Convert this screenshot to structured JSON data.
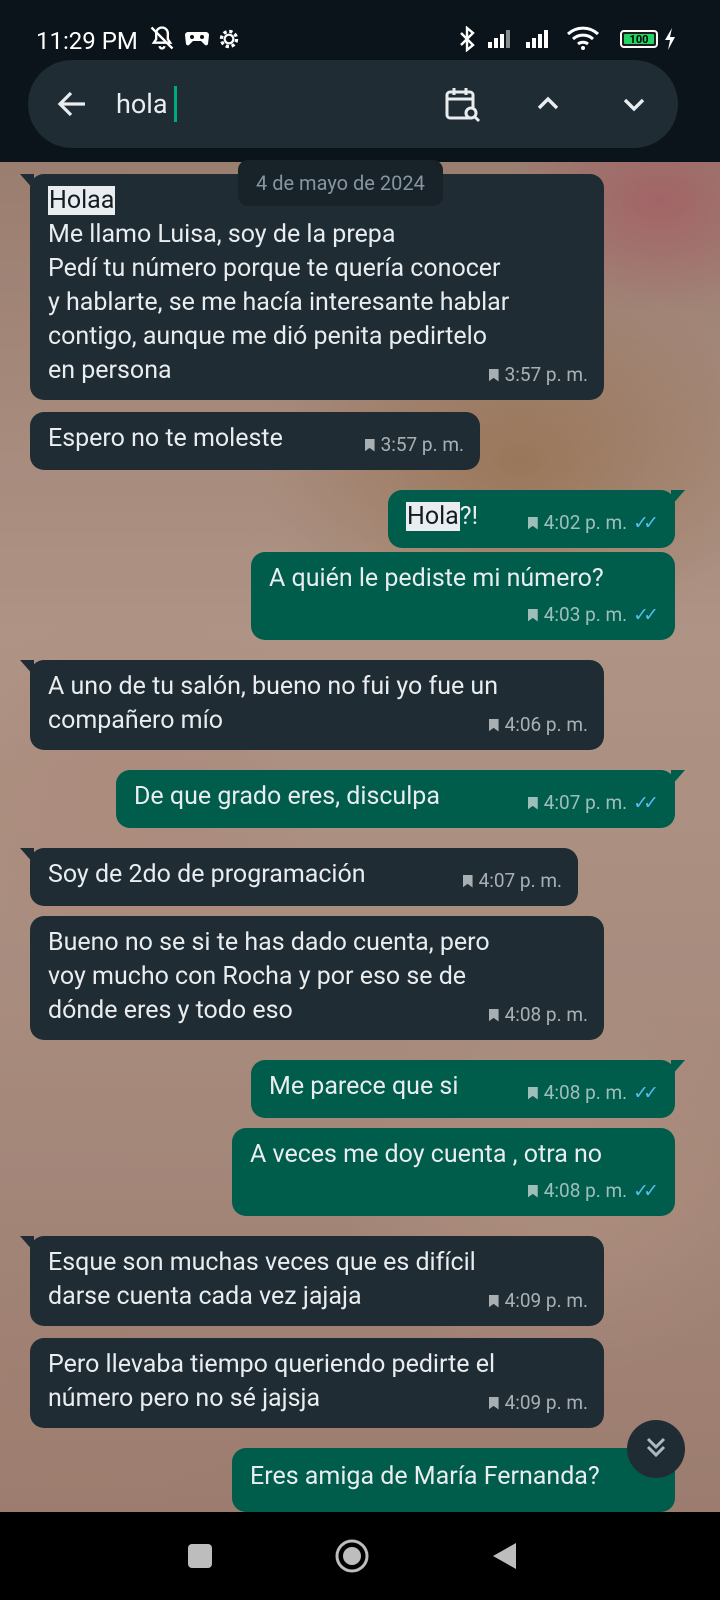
{
  "status_bar": {
    "time": "11:29 PM",
    "battery": "100",
    "icons": [
      "mute-notifications-icon",
      "gamepad-icon",
      "settings-gear-icon",
      "bluetooth-icon",
      "signal-icon",
      "signal-icon",
      "wifi-icon",
      "battery-icon",
      "charging-icon"
    ]
  },
  "search": {
    "query": "hola",
    "icons": [
      "back-arrow-icon",
      "calendar-search-icon",
      "chevron-up-icon",
      "chevron-down-icon"
    ]
  },
  "date_chip": "4 de mayo de 2024",
  "messages": [
    {
      "dir": "in",
      "highlight": "Holaa",
      "text": "\nMe llamo Luisa, soy de la prepa\nPedí tu número porque te quería conocer\ny hablarte, se me hacía interesante hablar\ncontigo, aunque me dió penita pedirtelo\nen persona",
      "time": "3:57 p. m."
    },
    {
      "dir": "in",
      "highlight": "",
      "text": "Espero no te moleste",
      "time": "3:57 p. m."
    },
    {
      "dir": "out",
      "highlight": "Hola",
      "text": "?!",
      "time": "4:02 p. m."
    },
    {
      "dir": "out",
      "highlight": "",
      "text": "A quién le pediste mi número?",
      "time": "4:03 p. m."
    },
    {
      "dir": "in",
      "highlight": "",
      "text": "A uno de tu salón, bueno no fui yo fue un\ncompañero mío",
      "time": "4:06 p. m."
    },
    {
      "dir": "out",
      "highlight": "",
      "text": "De que grado eres, disculpa",
      "time": "4:07 p. m."
    },
    {
      "dir": "in",
      "highlight": "",
      "text": "Soy de 2do de programación",
      "time": "4:07 p. m."
    },
    {
      "dir": "in",
      "highlight": "",
      "text": "Bueno no se si te has dado cuenta, pero\nvoy mucho con Rocha y por eso se de\ndónde eres y todo eso",
      "time": "4:08 p. m."
    },
    {
      "dir": "out",
      "highlight": "",
      "text": "Me parece que si",
      "time": "4:08 p. m."
    },
    {
      "dir": "out",
      "highlight": "",
      "text": "A veces me doy cuenta , otra no",
      "time": "4:08 p. m."
    },
    {
      "dir": "in",
      "highlight": "",
      "text": "Esque son muchas veces que es difícil\ndarse cuenta cada vez jajaja",
      "time": "4:09 p. m."
    },
    {
      "dir": "in",
      "highlight": "",
      "text": "Pero llevaba tiempo queriendo pedirte el\nnúmero pero no sé jajsja",
      "time": "4:09 p. m."
    },
    {
      "dir": "out",
      "highlight": "",
      "text": "Eres amiga de María Fernanda?",
      "time": ""
    }
  ],
  "scroll_down_icon": "double-chevron-down-icon",
  "nav": {
    "icons": [
      "recents-square-icon",
      "home-circle-icon",
      "back-triangle-icon"
    ]
  },
  "colors": {
    "incoming": "#202c33",
    "outgoing": "#005c4b",
    "accent": "#00a884",
    "read_ticks": "#53bdeb",
    "search_bg": "#1f2c34"
  }
}
